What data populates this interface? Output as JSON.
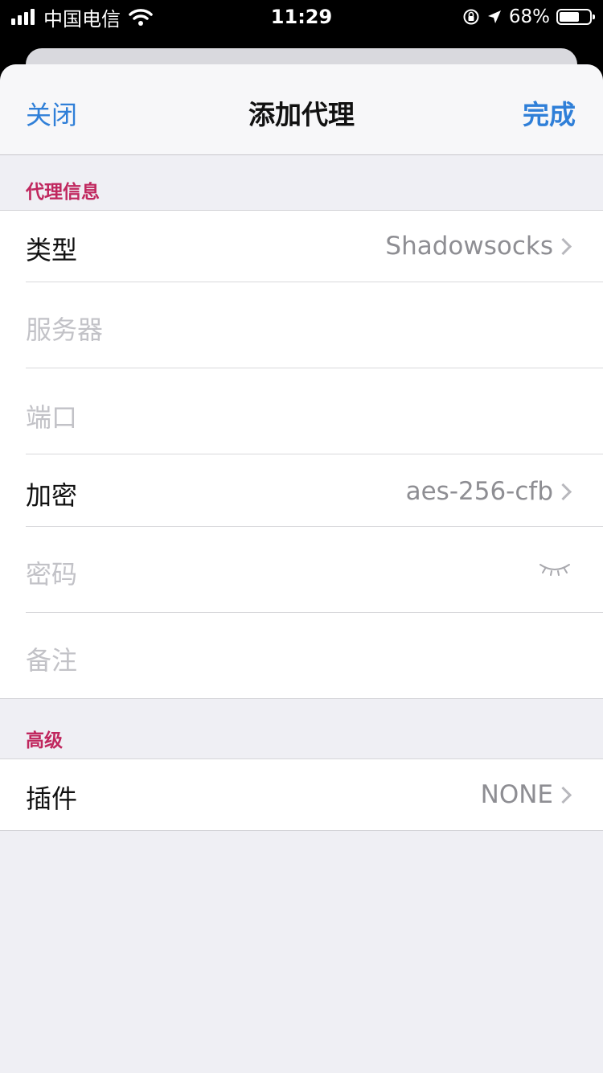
{
  "status_bar": {
    "carrier": "中国电信",
    "time": "11:29",
    "battery": "68%",
    "battery_level": 0.68
  },
  "nav": {
    "close": "关闭",
    "title": "添加代理",
    "done": "完成"
  },
  "section_proxy": {
    "header": "代理信息",
    "type_label": "类型",
    "type_value": "Shadowsocks",
    "server_placeholder": "服务器",
    "port_placeholder": "端口",
    "encryption_label": "加密",
    "encryption_value": "aes-256-cfb",
    "password_placeholder": "密码",
    "note_placeholder": "备注"
  },
  "section_advanced": {
    "header": "高级",
    "plugin_label": "插件",
    "plugin_value": "NONE"
  },
  "colors": {
    "accent": "#2f7fd8",
    "section_header": "#c0275e",
    "placeholder": "#c2c2c7",
    "background": "#efeff4"
  }
}
